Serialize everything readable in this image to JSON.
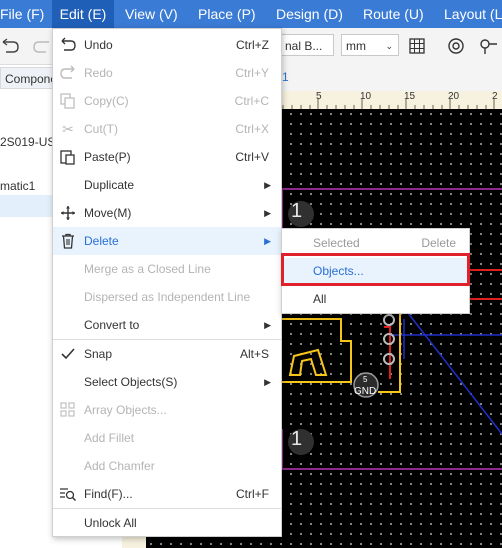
{
  "menubar": {
    "items": [
      "File (F)",
      "Edit (E)",
      "View (V)",
      "Place (P)",
      "Design (D)",
      "Route (U)",
      "Layout (L"
    ]
  },
  "toolbar": {
    "layer_select": "nal B...",
    "unit_select": "mm"
  },
  "left_panel": {
    "tab_label": "Compone",
    "item_project": "2S019-US",
    "item_schematic": "matic1"
  },
  "canvas": {
    "tab_label": "1",
    "ruler_ticks": [
      "5",
      "10",
      "15",
      "20",
      "2"
    ],
    "mark_1": "1",
    "mark_2": "1",
    "gnd_label": "GND",
    "gnd_pin": "5"
  },
  "edit_menu": {
    "items": [
      {
        "label": "Undo",
        "shortcut": "Ctrl+Z",
        "icon": "undo-icon",
        "disabled": false
      },
      {
        "label": "Redo",
        "shortcut": "Ctrl+Y",
        "icon": "redo-icon",
        "disabled": true
      },
      {
        "label": "Copy(C)",
        "shortcut": "Ctrl+C",
        "icon": "copy-icon",
        "disabled": true
      },
      {
        "label": "Cut(T)",
        "shortcut": "Ctrl+X",
        "icon": "scissors-icon",
        "disabled": true
      },
      {
        "label": "Paste(P)",
        "shortcut": "Ctrl+V",
        "icon": "paste-icon",
        "disabled": false
      },
      {
        "label": "Duplicate",
        "submenu": true,
        "disabled": false
      },
      {
        "label": "Move(M)",
        "icon": "move-icon",
        "submenu": true,
        "disabled": false
      },
      {
        "label": "Delete",
        "icon": "trash-icon",
        "submenu": true,
        "highlighted": true
      },
      {
        "label": "Merge as a Closed Line",
        "disabled": true
      },
      {
        "label": "Dispersed as Independent Line",
        "disabled": true
      },
      {
        "label": "Convert to",
        "submenu": true,
        "disabled": false
      },
      {
        "label": "Snap",
        "shortcut": "Alt+S",
        "icon": "checkmark-icon",
        "disabled": false
      },
      {
        "label": "Select Objects(S)",
        "submenu": true,
        "disabled": false
      },
      {
        "label": "Array Objects...",
        "icon": "array-icon",
        "disabled": true
      },
      {
        "label": "Add Fillet",
        "disabled": true
      },
      {
        "label": "Add Chamfer",
        "disabled": true
      },
      {
        "label": "Find(F)...",
        "shortcut": "Ctrl+F",
        "icon": "find-icon",
        "disabled": false
      },
      {
        "label": "Unlock All",
        "disabled": false
      }
    ]
  },
  "delete_submenu": {
    "header_left": "Selected",
    "header_right": "Delete",
    "objects": "Objects...",
    "all": "All"
  },
  "colors": {
    "menubar": "#3a7bd5",
    "highlight": "#e8f3fd",
    "highlight_text": "#2a6fd4",
    "callout": "#e0202a",
    "pcb_background": "#000000",
    "silkscreen": "#f5c518",
    "outline": "#8b2a8b",
    "track_red": "#e02020",
    "track_blue": "#2030c8"
  }
}
